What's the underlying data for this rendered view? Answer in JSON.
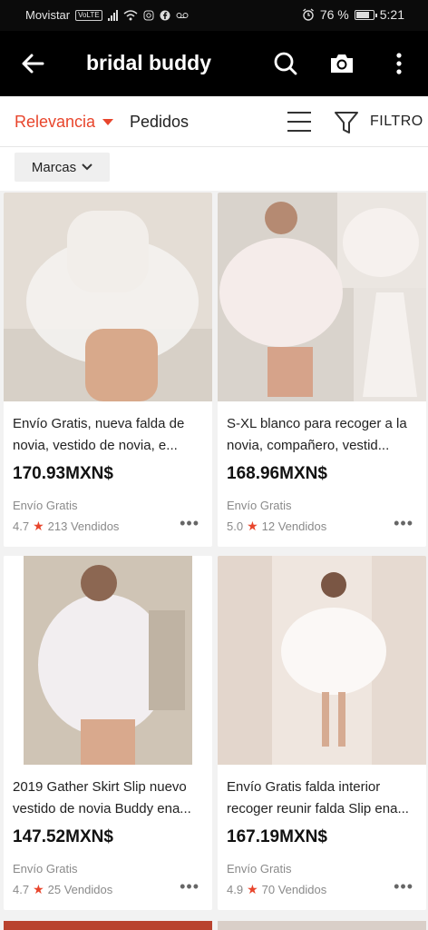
{
  "status_bar": {
    "carrier": "Movistar",
    "volte": "VoLTE",
    "battery": "76 %",
    "time": "5:21"
  },
  "header": {
    "search_query": "bridal buddy",
    "icons": [
      "back-arrow-icon",
      "search-icon",
      "camera-icon",
      "more-vertical-icon"
    ]
  },
  "sort": {
    "relevance": "Relevancia",
    "orders": "Pedidos",
    "filter": "FILTRO"
  },
  "chips": {
    "brands": "Marcas"
  },
  "products": [
    {
      "title": "Envío Gratis, nueva falda de novia, vestido de novia, e...",
      "price": "170.93MXN$",
      "shipping": "Envío Gratis",
      "rating": "4.7",
      "sold": "213 Vendidos"
    },
    {
      "title": "S-XL blanco para recoger a la novia, compañero, vestid...",
      "price": "168.96MXN$",
      "shipping": "Envío Gratis",
      "rating": "5.0",
      "sold": "12 Vendidos"
    },
    {
      "title": "2019 Gather Skirt Slip nuevo vestido de novia Buddy ena...",
      "price": "147.52MXN$",
      "shipping": "Envío Gratis",
      "rating": "4.7",
      "sold": "25 Vendidos"
    },
    {
      "title": "Envío Gratis falda interior recoger reunir falda Slip ena...",
      "price": "167.19MXN$",
      "shipping": "Envío Gratis",
      "rating": "4.9",
      "sold": "70 Vendidos"
    }
  ],
  "colors": {
    "accent": "#e8452c",
    "header_bg": "#000000"
  }
}
